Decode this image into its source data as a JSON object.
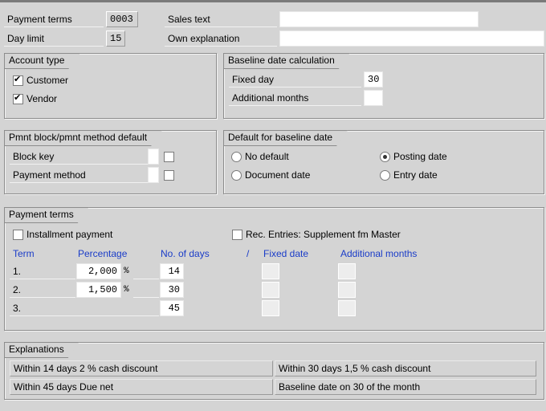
{
  "header": {
    "payment_terms_label": "Payment terms",
    "payment_terms_value": "0003",
    "day_limit_label": "Day limit",
    "day_limit_value": "15",
    "sales_text_label": "Sales text",
    "sales_text_value": "",
    "own_explanation_label": "Own explanation",
    "own_explanation_value": ""
  },
  "account_type": {
    "title": "Account type",
    "customer_label": "Customer",
    "customer_checked": true,
    "vendor_label": "Vendor",
    "vendor_checked": true
  },
  "baseline_calc": {
    "title": "Baseline date calculation",
    "fixed_day_label": "Fixed day",
    "fixed_day_value": "30",
    "additional_months_label": "Additional months",
    "additional_months_value": ""
  },
  "pmnt_block": {
    "title": "Pmnt block/pmnt method default",
    "block_key_label": "Block key",
    "payment_method_label": "Payment method"
  },
  "default_baseline": {
    "title": "Default for baseline date",
    "no_default": "No default",
    "posting_date": "Posting date",
    "document_date": "Document date",
    "entry_date": "Entry date",
    "selected": "posting_date"
  },
  "payment_terms": {
    "title": "Payment terms",
    "installment_label": "Installment payment",
    "rec_entries_label": "Rec. Entries: Supplement fm Master",
    "col_term": "Term",
    "col_percentage": "Percentage",
    "col_days": "No. of days",
    "col_slash": "/",
    "col_fixed_date": "Fixed date",
    "col_additional_months": "Additional months",
    "rows": [
      {
        "term": "1.",
        "percentage": "2,000",
        "pct_sign": "%",
        "days": "14"
      },
      {
        "term": "2.",
        "percentage": "1,500",
        "pct_sign": "%",
        "days": "30"
      },
      {
        "term": "3.",
        "percentage": "",
        "pct_sign": "",
        "days": "45"
      }
    ]
  },
  "explanations": {
    "title": "Explanations",
    "lines": [
      "Within 14 days 2 % cash discount",
      "Within 30 days 1,5 % cash discount",
      "Within 45 days Due net",
      "Baseline date on 30 of the month"
    ]
  }
}
